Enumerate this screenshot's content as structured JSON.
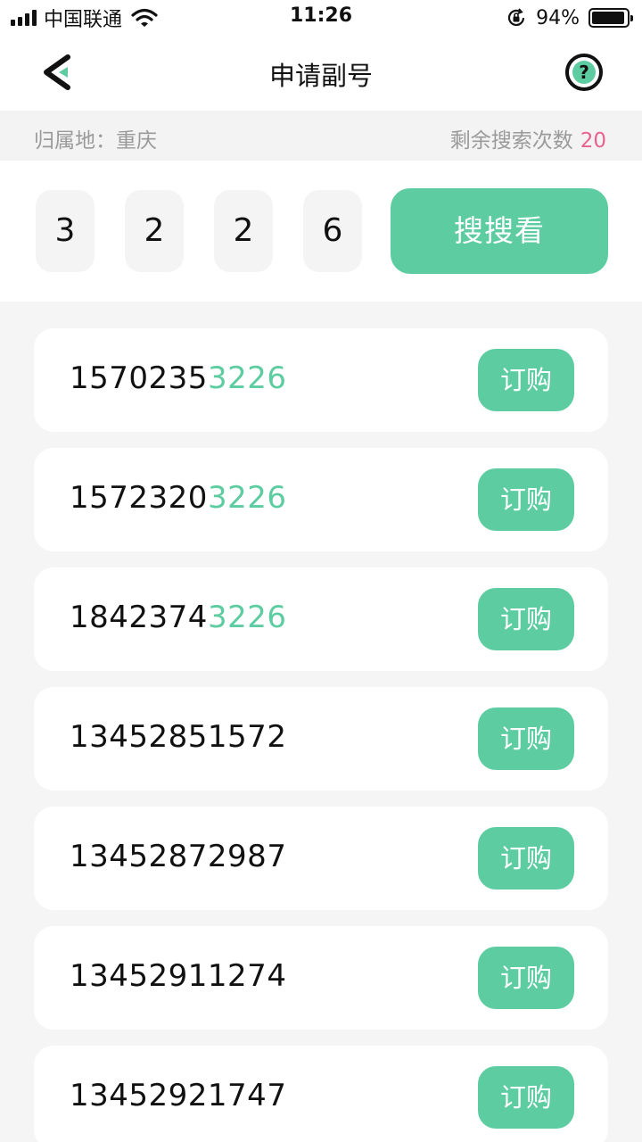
{
  "status_bar": {
    "carrier": "中国联通",
    "time": "11:26",
    "battery_percent": "94%",
    "battery_level": 0.94,
    "icons": [
      "signal-icon",
      "wifi-icon",
      "orientation-lock-icon",
      "battery-icon"
    ]
  },
  "nav": {
    "title": "申请副号",
    "back_icon": "back-arrow-icon",
    "help_icon": "question-mark-icon"
  },
  "info": {
    "region_label": "归属地：重庆",
    "remaining_label": "剩余搜索次数",
    "remaining_count": "20"
  },
  "search": {
    "digits": [
      "3",
      "2",
      "2",
      "6"
    ],
    "button_label": "搜搜看"
  },
  "results": [
    {
      "prefix": "1570235",
      "match": "3226",
      "button": "订购"
    },
    {
      "prefix": "1572320",
      "match": "3226",
      "button": "订购"
    },
    {
      "prefix": "1842374",
      "match": "3226",
      "button": "订购"
    },
    {
      "prefix": "13452851572",
      "match": "",
      "button": "订购"
    },
    {
      "prefix": "13452872987",
      "match": "",
      "button": "订购"
    },
    {
      "prefix": "13452911274",
      "match": "",
      "button": "订购"
    },
    {
      "prefix": "13452921747",
      "match": "",
      "button": "订购"
    }
  ],
  "colors": {
    "accent": "#5dcda1",
    "count_highlight": "#e8628f",
    "muted_text": "#9a9a9a",
    "page_background": "#f5f5f5"
  }
}
